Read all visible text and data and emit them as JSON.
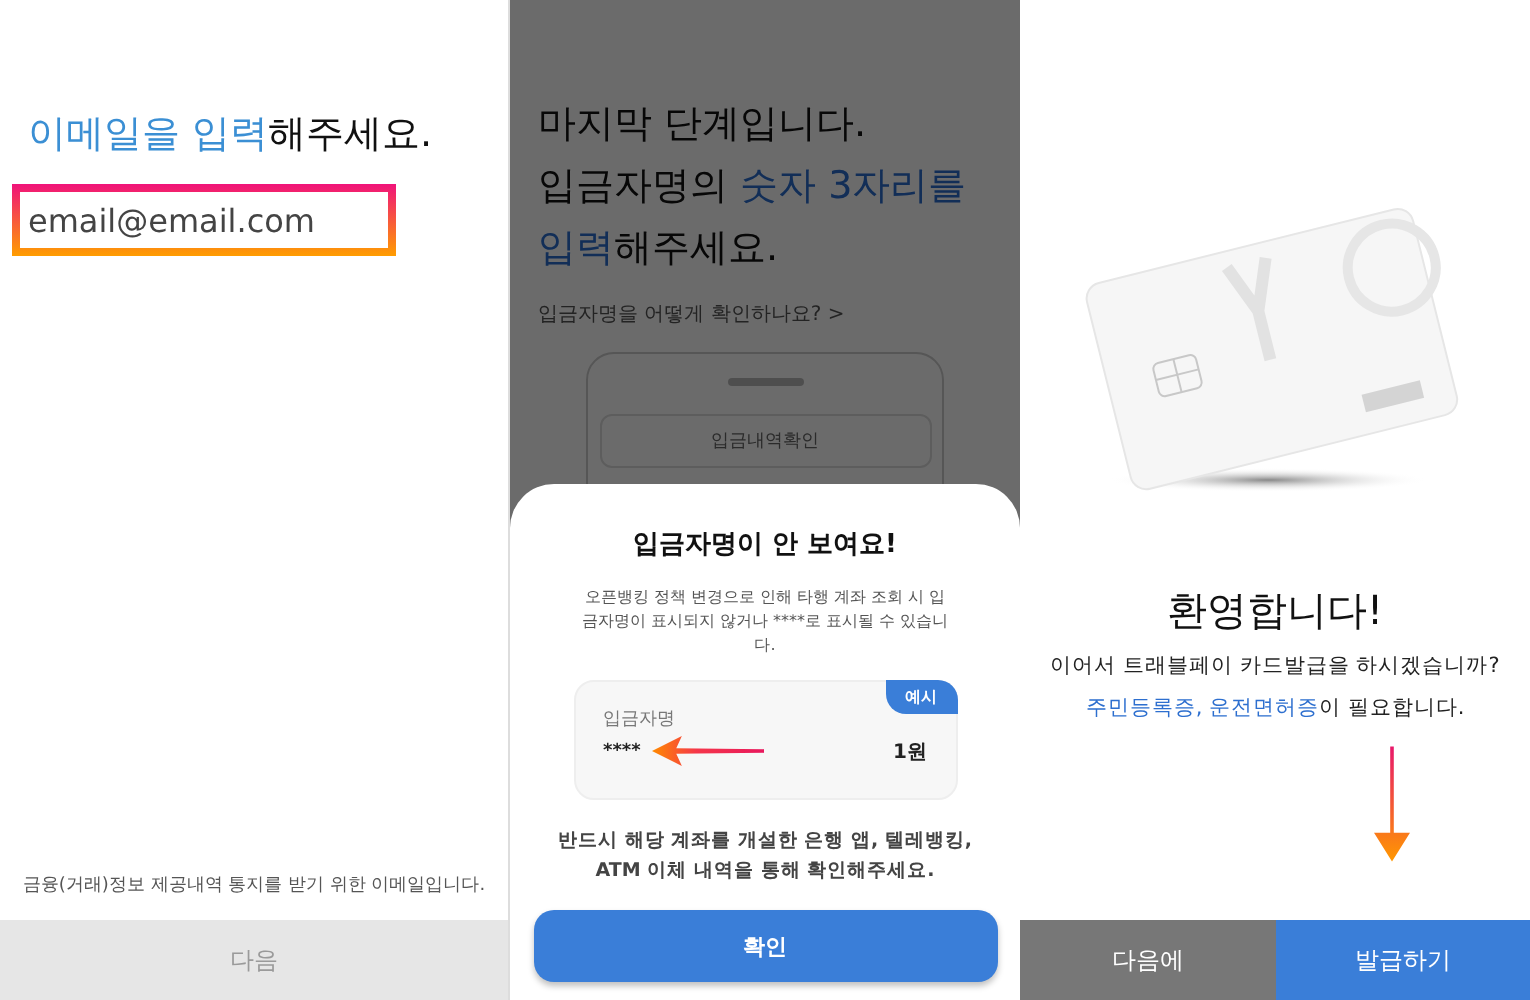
{
  "email_screen": {
    "title_parts": [
      {
        "text": "이메일을 입력",
        "highlight": true
      },
      {
        "text": "해주세요.",
        "highlight": false
      }
    ],
    "email_field": {
      "value": "email@email.com"
    },
    "note": "금융(거래)정보 제공내역 통지를 받기 위한 이메일입니다.",
    "next_button": {
      "label": "다음",
      "disabled": true
    }
  },
  "depositor_screen": {
    "title_lines": [
      [
        {
          "text": "마지막 단계입니다.",
          "highlight": false
        }
      ],
      [
        {
          "text": "입금자명의 ",
          "highlight": false
        },
        {
          "text": "숫자 3자리를",
          "highlight": true
        }
      ],
      [
        {
          "text": "입력",
          "highlight": true
        },
        {
          "text": "해주세요.",
          "highlight": false
        }
      ]
    ],
    "help_link": "입금자명을 어떻게 확인하나요? >",
    "preview_label": "입금내역확인",
    "sheet": {
      "title": "입금자명이 안 보여요!",
      "description": "오픈뱅킹 정책 변경으로 인해 타행 계좌 조회 시 입금자명이 표시되지 않거나 ****로 표시될 수 있습니다.",
      "example": {
        "badge": "예시",
        "label": "입금자명",
        "name": "****",
        "amount": "1원"
      },
      "note": "반드시 해당 계좌를 개설한 은행 앱, 텔레뱅킹, ATM 이체 내역을 통해 확인해주세요.",
      "confirm_button": "확인"
    }
  },
  "welcome_screen": {
    "title": "환영합니다!",
    "question": "이어서 트래블페이 카드발급을 하시겠습니까?",
    "requirement_parts": [
      {
        "text": "주민등록증, 운전면허증",
        "highlight": true
      },
      {
        "text": "이 필요합니다.",
        "highlight": false
      }
    ],
    "buttons": [
      {
        "label": "다음에",
        "kind": "secondary"
      },
      {
        "label": "발급하기",
        "kind": "primary"
      }
    ]
  }
}
